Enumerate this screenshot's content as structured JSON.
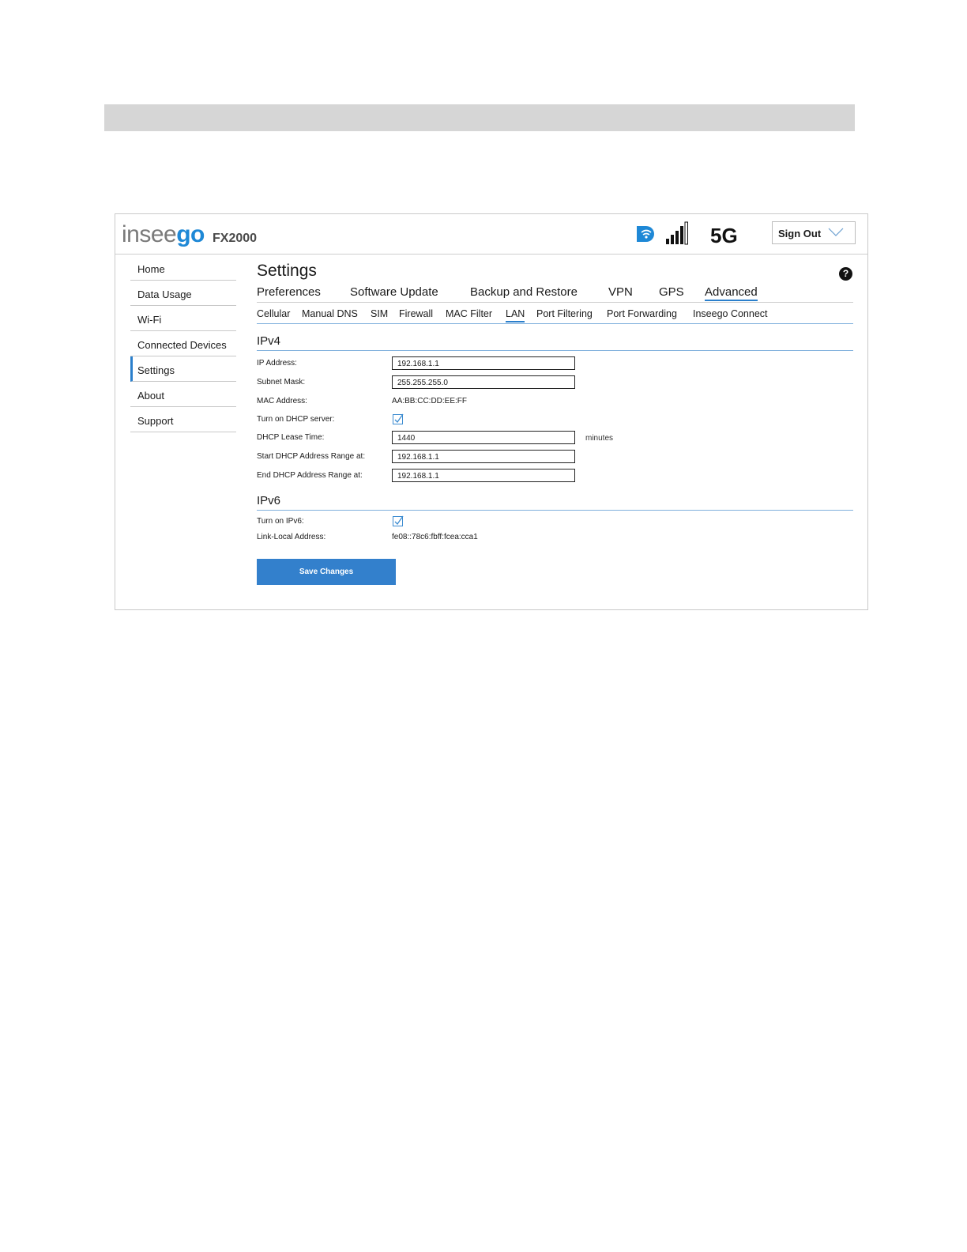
{
  "header": {
    "logo_text_plain": "insee",
    "logo_text_accent": "go",
    "model": "FX2000",
    "network_type": "5G",
    "sign_out_label": "Sign Out"
  },
  "sidebar": {
    "items": [
      {
        "label": "Home"
      },
      {
        "label": "Data Usage"
      },
      {
        "label": "Wi-Fi"
      },
      {
        "label": "Connected Devices"
      },
      {
        "label": "Settings"
      },
      {
        "label": "About"
      },
      {
        "label": "Support"
      }
    ],
    "active": "Settings"
  },
  "main": {
    "title": "Settings",
    "tabs": [
      {
        "label": "Preferences"
      },
      {
        "label": "Software Update"
      },
      {
        "label": "Backup and Restore"
      },
      {
        "label": "VPN"
      },
      {
        "label": "GPS"
      },
      {
        "label": "Advanced"
      }
    ],
    "active_tab": "Advanced",
    "subtabs": [
      {
        "label": "Cellular"
      },
      {
        "label": "Manual DNS"
      },
      {
        "label": "SIM"
      },
      {
        "label": "Firewall"
      },
      {
        "label": "MAC Filter"
      },
      {
        "label": "LAN"
      },
      {
        "label": "Port Filtering"
      },
      {
        "label": "Port Forwarding"
      },
      {
        "label": "Inseego Connect"
      }
    ],
    "active_subtab": "LAN"
  },
  "ipv4": {
    "heading": "IPv4",
    "ip_address_label": "IP Address:",
    "ip_address_value": "192.168.1.1",
    "subnet_mask_label": "Subnet Mask:",
    "subnet_mask_value": "255.255.255.0",
    "mac_address_label": "MAC Address:",
    "mac_address_value": "AA:BB:CC:DD:EE:FF",
    "dhcp_server_label": "Turn on DHCP server:",
    "dhcp_server_checked": true,
    "lease_time_label": "DHCP Lease Time:",
    "lease_time_value": "1440",
    "lease_time_unit": "minutes",
    "start_range_label": "Start DHCP Address Range at:",
    "start_range_value": "192.168.1.1",
    "end_range_label": "End DHCP Address Range at:",
    "end_range_value": "192.168.1.1"
  },
  "ipv6": {
    "heading": "IPv6",
    "turn_on_label": "Turn on IPv6:",
    "turn_on_checked": true,
    "link_local_label": "Link-Local Address:",
    "link_local_value": "fe08::78c6:fbff:fcea:cca1"
  },
  "actions": {
    "save_label": "Save Changes"
  },
  "colors": {
    "accent": "#2a7fcc",
    "button": "#3380cc",
    "logo_accent": "#1e88d6"
  }
}
